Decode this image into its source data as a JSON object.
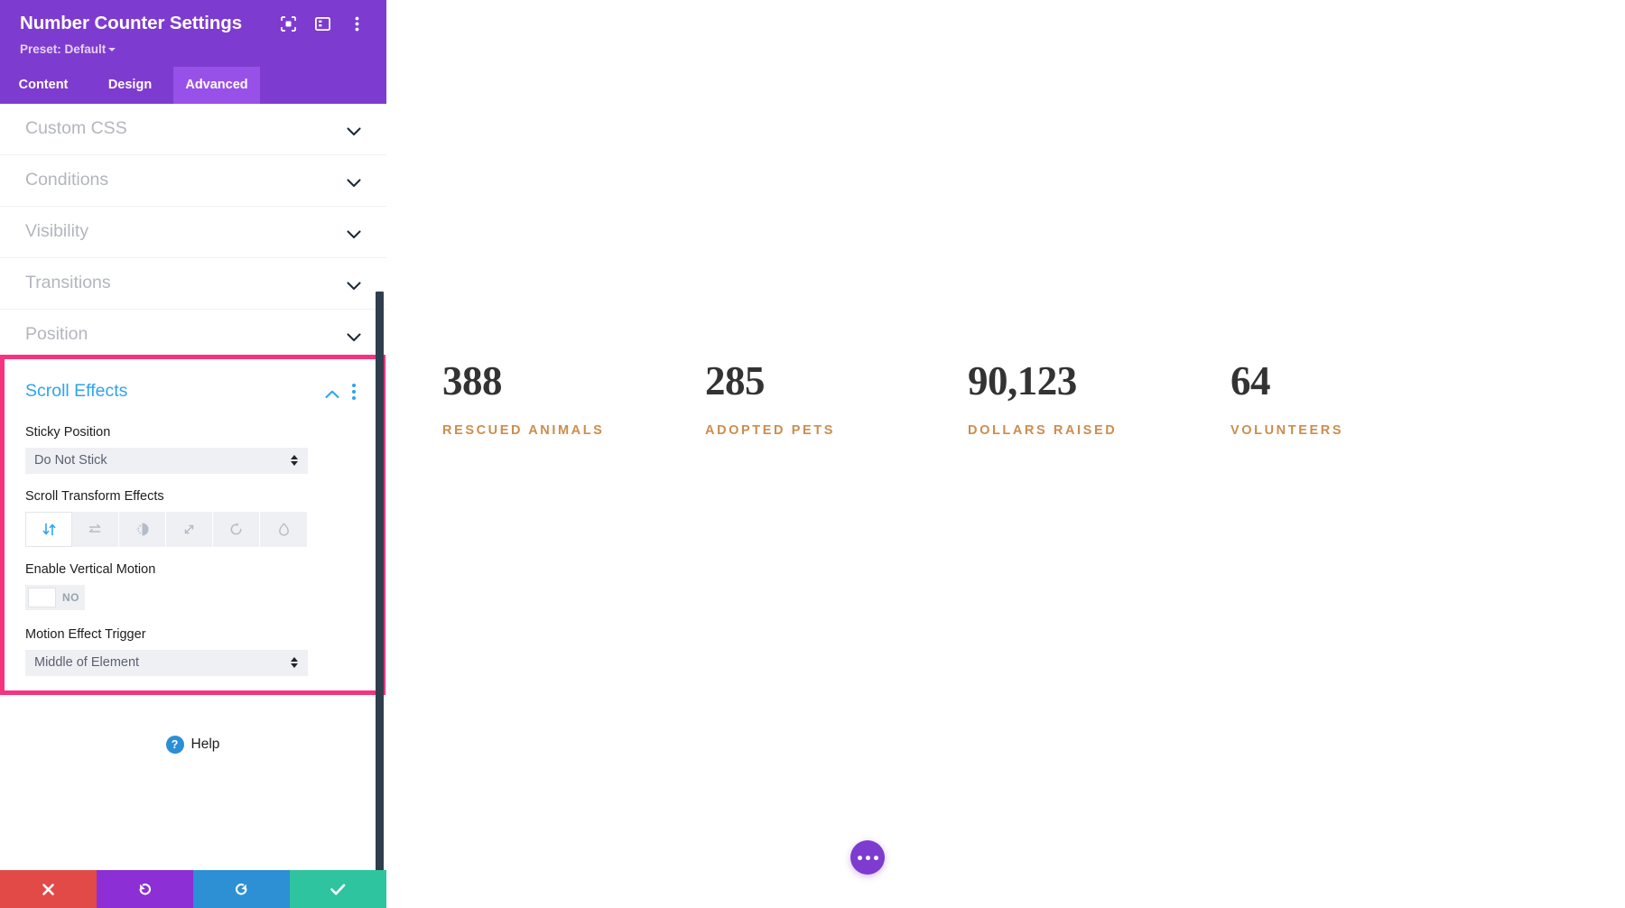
{
  "panel": {
    "title": "Number Counter Settings",
    "preset_label": "Preset: Default",
    "header_icons": [
      {
        "name": "focus-icon",
        "label": "focus"
      },
      {
        "name": "layout-panel-icon",
        "label": "layout"
      },
      {
        "name": "more-vertical-icon",
        "label": "more"
      }
    ],
    "tabs": [
      {
        "label": "Content",
        "active": false
      },
      {
        "label": "Design",
        "active": false
      },
      {
        "label": "Advanced",
        "active": true
      }
    ],
    "accordions": [
      {
        "label": "Custom CSS",
        "expanded": false
      },
      {
        "label": "Conditions",
        "expanded": false
      },
      {
        "label": "Visibility",
        "expanded": false
      },
      {
        "label": "Transitions",
        "expanded": false
      },
      {
        "label": "Position",
        "expanded": false
      }
    ],
    "scroll_effects": {
      "title": "Scroll Effects",
      "expanded": true,
      "highlight_color": "#f7337f",
      "title_color": "#2ea3f2",
      "sticky_position": {
        "label": "Sticky Position",
        "value": "Do Not Stick"
      },
      "scroll_transform_effects": {
        "label": "Scroll Transform Effects",
        "options": [
          {
            "name": "vertical-motion-icon",
            "title": "Vertical Motion",
            "active": true
          },
          {
            "name": "horizontal-motion-icon",
            "title": "Horizontal Motion",
            "active": false
          },
          {
            "name": "fade-in-out-icon",
            "title": "Fading In and Out",
            "active": false
          },
          {
            "name": "scaling-icon",
            "title": "Scaling Up and Down",
            "active": false
          },
          {
            "name": "rotating-icon",
            "title": "Rotating",
            "active": false
          },
          {
            "name": "blur-icon",
            "title": "Blur",
            "active": false
          }
        ]
      },
      "enable_vertical_motion": {
        "label": "Enable Vertical Motion",
        "state_label": "NO",
        "on": false
      },
      "motion_effect_trigger": {
        "label": "Motion Effect Trigger",
        "value": "Middle of Element"
      }
    },
    "help": {
      "label": "Help",
      "icon_glyph": "?"
    },
    "footer_buttons": [
      {
        "name": "cancel-button",
        "glyph": "✖",
        "color": "#e24a47"
      },
      {
        "name": "undo-button",
        "glyph": "↺",
        "color": "#8c2fd4"
      },
      {
        "name": "redo-button",
        "glyph": "↻",
        "color": "#2d8fd4"
      },
      {
        "name": "save-button",
        "glyph": "✔",
        "color": "#2ec4a0"
      }
    ]
  },
  "preview": {
    "counters": [
      {
        "number": "388",
        "label": "RESCUED ANIMALS"
      },
      {
        "number": "285",
        "label": "ADOPTED PETS"
      },
      {
        "number": "90,123",
        "label": "DOLLARS RAISED"
      },
      {
        "number": "64",
        "label": "VOLUNTEERS"
      }
    ],
    "number_color": "#333333",
    "label_color": "#cc8d4e",
    "fab": {
      "name": "page-settings-fab",
      "dots": 3,
      "color": "#7e3bd0"
    }
  }
}
